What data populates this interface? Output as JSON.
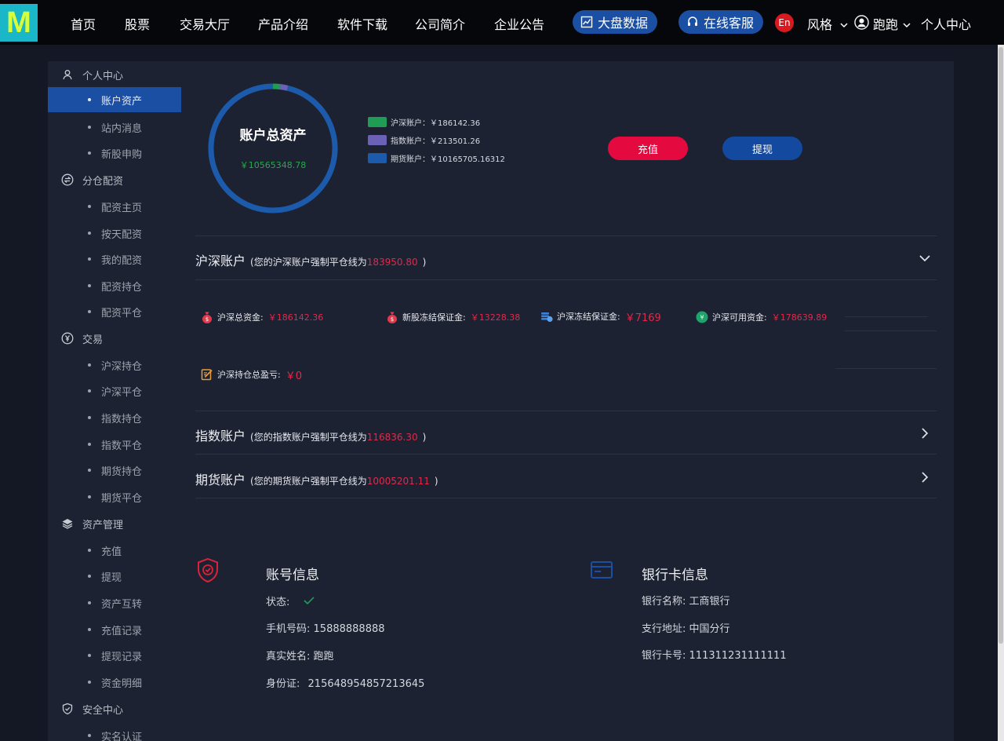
{
  "logo_text": "M",
  "nav": {
    "items": [
      "首页",
      "股票",
      "交易大厅",
      "产品介绍",
      "软件下载",
      "公司简介",
      "企业公告"
    ],
    "market_btn": "大盘数据",
    "service_btn": "在线客服",
    "lang": "En",
    "style_label": "风格",
    "user_name": "跑跑",
    "personal_center": "个人中心"
  },
  "sidebar": {
    "personal": {
      "label": "个人中心",
      "items": [
        "账户资产",
        "站内消息",
        "新股申购"
      ]
    },
    "allocation": {
      "label": "分仓配资",
      "items": [
        "配资主页",
        "按天配资",
        "我的配资",
        "配资持仓",
        "配资平仓"
      ]
    },
    "trade": {
      "label": "交易",
      "items": [
        "沪深持仓",
        "沪深平仓",
        "指数持仓",
        "指数平仓",
        "期货持仓",
        "期货平仓"
      ]
    },
    "assets": {
      "label": "资产管理",
      "items": [
        "充值",
        "提现",
        "资产互转",
        "充值记录",
        "提现记录",
        "资金明细"
      ]
    },
    "security": {
      "label": "安全中心",
      "items": [
        "实名认证"
      ]
    }
  },
  "summary": {
    "title": "账户总资产",
    "total": "￥10565348.78",
    "legend": [
      {
        "label": "沪深账户：￥186142.36",
        "color": "#1f9d55",
        "value": 186142.36
      },
      {
        "label": "指数账户：￥213501.26",
        "color": "#6b62b8",
        "value": 213501.26
      },
      {
        "label": "期货账户：￥10165705.16312",
        "color": "#1c5bab",
        "value": 10165705.16312
      }
    ],
    "deposit_btn": "充值",
    "withdraw_btn": "提现"
  },
  "hs_account": {
    "title": "沪深账户",
    "note_prefix": "(您的沪深账户强制平仓线为",
    "line_value": "183950.80",
    "note_suffix": ")",
    "stats": [
      {
        "label": "沪深总资金:",
        "value": "￥186142.36"
      },
      {
        "label": "新股冻结保证金:",
        "value": "￥13228.38"
      },
      {
        "label": "沪深冻结保证金:",
        "value": "￥7169"
      },
      {
        "label": "沪深可用资金:",
        "value": "￥178639.89"
      },
      {
        "label": "沪深持仓总盈亏:",
        "value": "￥0"
      }
    ]
  },
  "index_account": {
    "title": "指数账户",
    "note_prefix": "(您的指数账户强制平仓线为",
    "line_value": "116836.30",
    "note_suffix": ")"
  },
  "futures_account": {
    "title": "期货账户",
    "note_prefix": "(您的期货账户强制平仓线为",
    "line_value": "10005201.11",
    "note_suffix": ")"
  },
  "account_info": {
    "title": "账号信息",
    "status_label": "状态:",
    "phone_label": "手机号码:",
    "phone": "15888888888",
    "name_label": "真实姓名:",
    "name": "跑跑",
    "id_label": "身份证:",
    "id": "215648954857213645"
  },
  "bank_info": {
    "title": "银行卡信息",
    "bank_label": "银行名称:",
    "bank": "工商银行",
    "branch_label": "支行地址:",
    "branch": "中国分行",
    "card_label": "银行卡号:",
    "card": "111311231111111"
  },
  "colors": {
    "accent_blue": "#1b4fa3",
    "danger_red": "#e0294a",
    "deposit_red": "#e4093f",
    "success_green": "#27a84a"
  }
}
